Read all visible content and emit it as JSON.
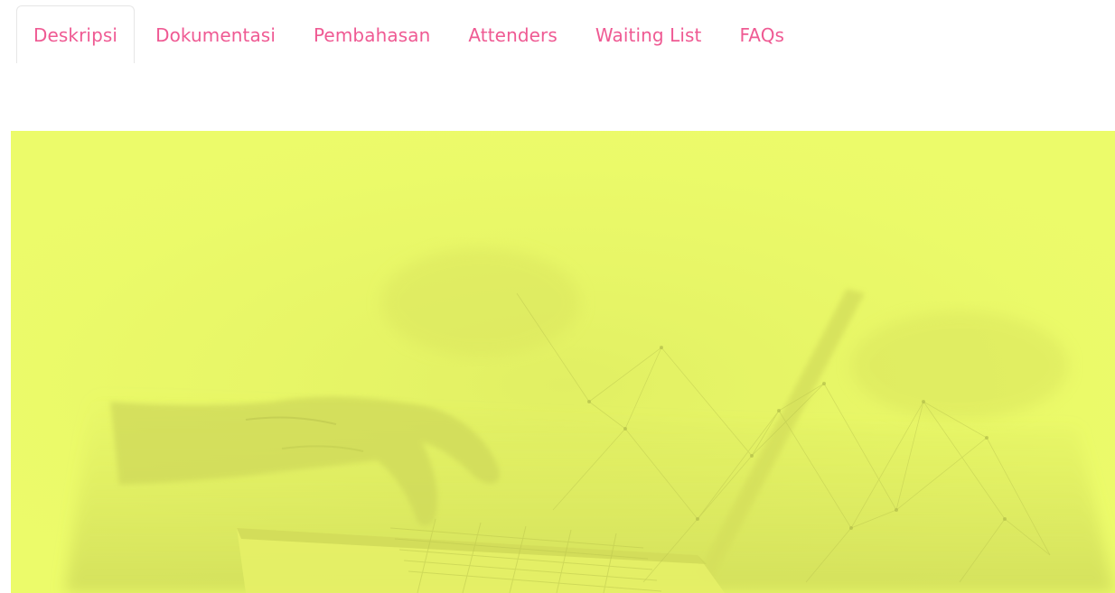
{
  "tabs": [
    {
      "label": "Deskripsi",
      "active": true
    },
    {
      "label": "Dokumentasi",
      "active": false
    },
    {
      "label": "Pembahasan",
      "active": false
    },
    {
      "label": "Attenders",
      "active": false
    },
    {
      "label": "Waiting List",
      "active": false
    },
    {
      "label": "FAQs",
      "active": false
    }
  ],
  "colors": {
    "tab_text": "#ef5a93",
    "active_tab_border": "#e6e6e6",
    "hero_overlay": "#ecfb6a"
  },
  "hero": {
    "image": "laptop-typing-hand-network-lines-icon"
  }
}
